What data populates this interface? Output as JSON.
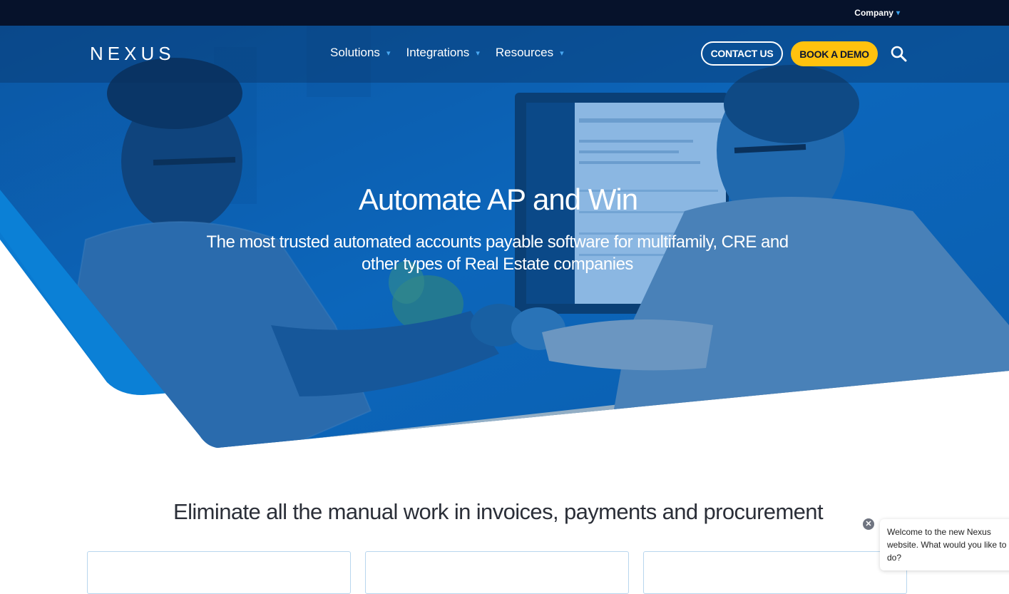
{
  "topbar": {
    "company_label": "Company",
    "company_caret": "▾"
  },
  "header": {
    "logo_text": "NEXUS",
    "nav": [
      {
        "label": "Solutions",
        "caret": "▾"
      },
      {
        "label": "Integrations",
        "caret": "▾"
      },
      {
        "label": "Resources",
        "caret": "▾"
      }
    ],
    "contact_label": "CONTACT US",
    "demo_label": "BOOK A DEMO",
    "search_icon": "search-icon"
  },
  "hero": {
    "title": "Automate AP and Win",
    "subtitle": "The most trusted automated accounts payable software for multifamily, CRE and other types of Real Estate companies"
  },
  "section": {
    "title": "Eliminate all the manual work in invoices, payments and procurement"
  },
  "chat": {
    "close_glyph": "✕",
    "message": "Welcome to the new Nexus website. What would you like to do?"
  },
  "colors": {
    "topbar": "#06122b",
    "hero_blue": "#0a5fae",
    "accent_yellow": "#ffc20e",
    "caret_blue": "#3aa3f0"
  }
}
